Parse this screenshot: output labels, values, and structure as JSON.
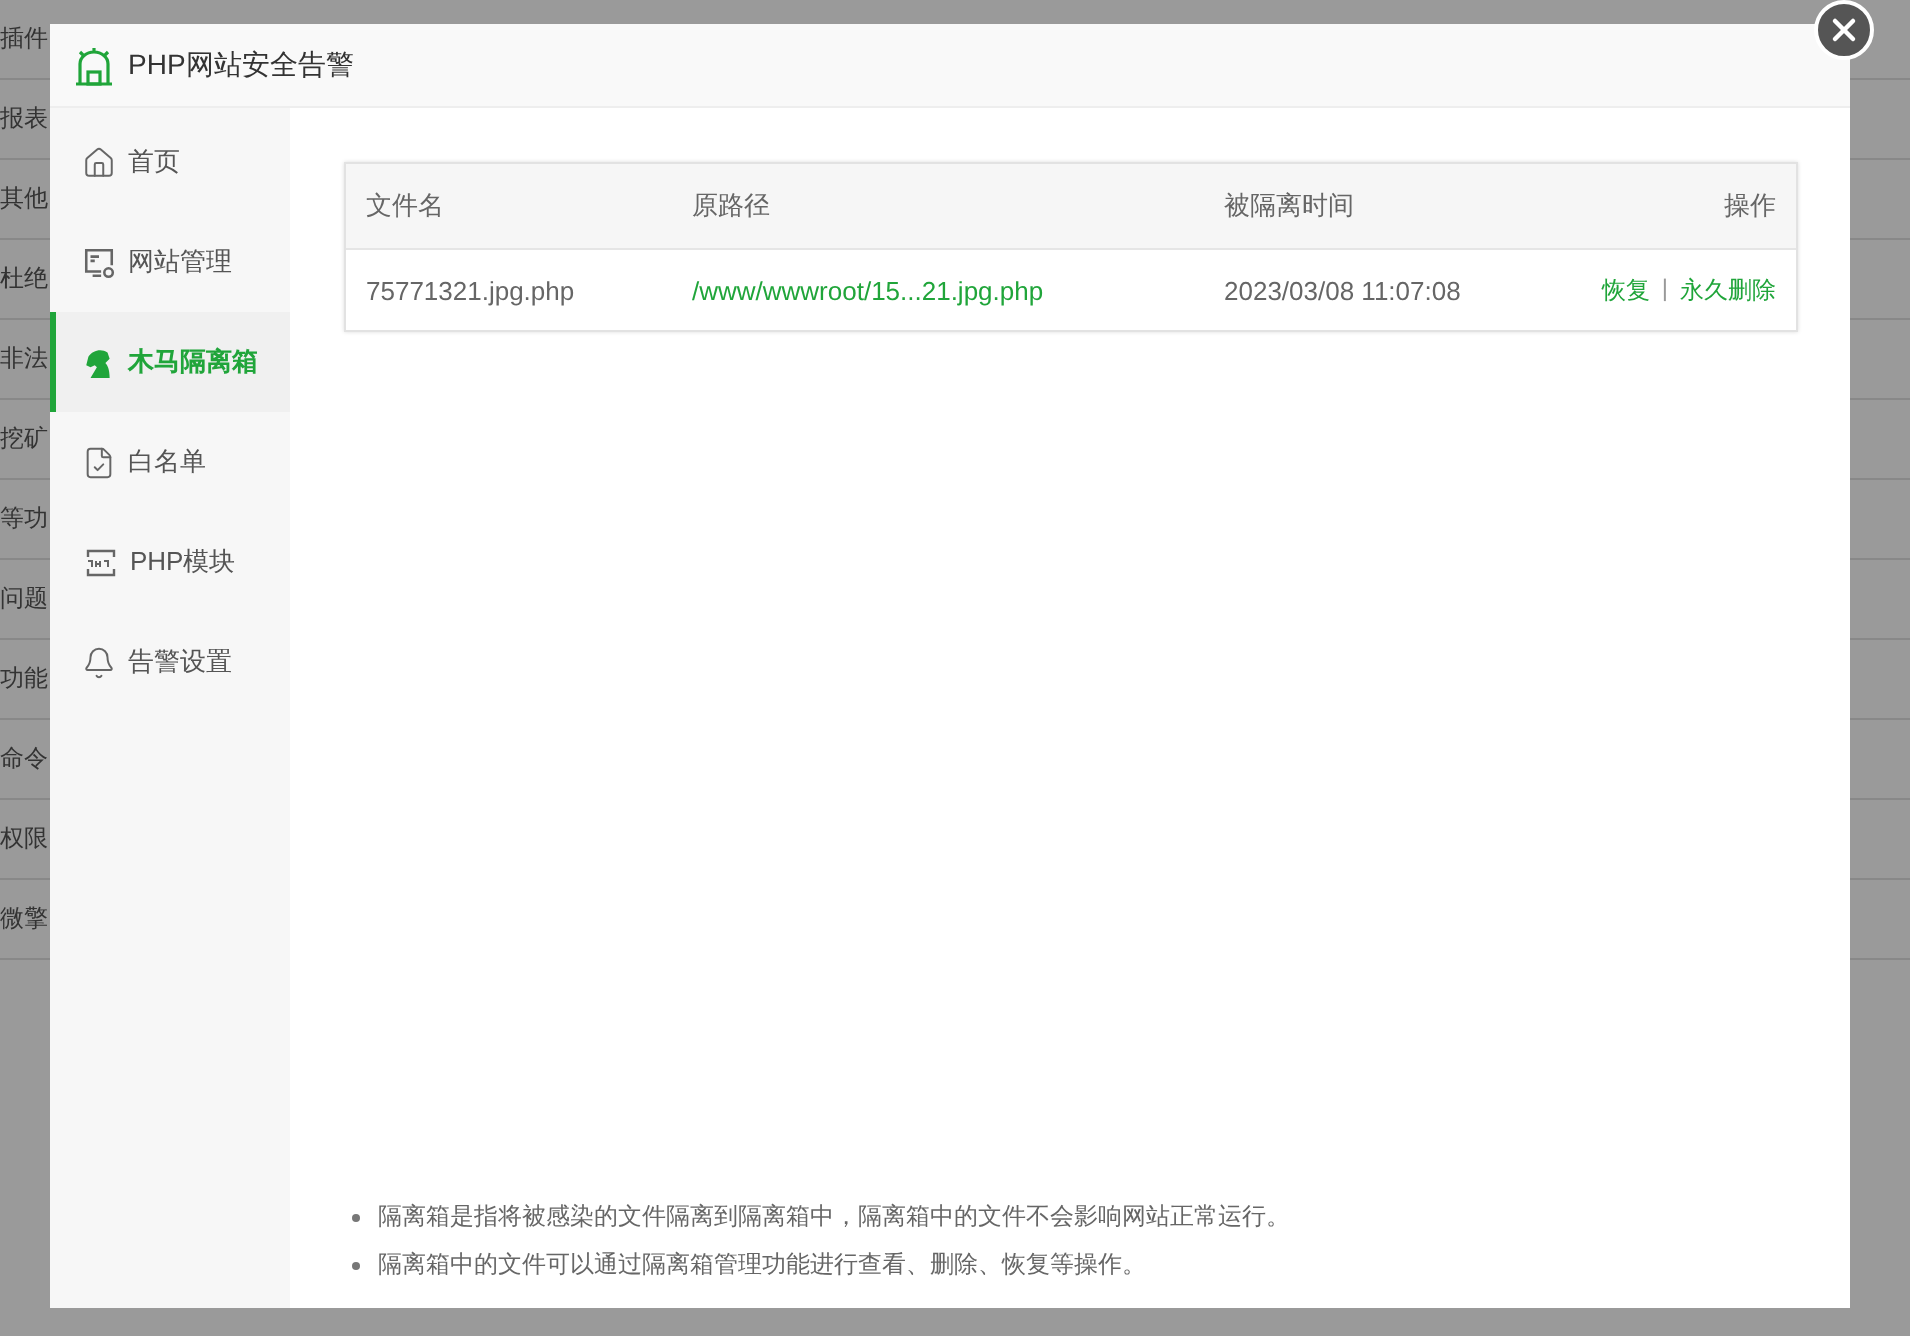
{
  "background_page": {
    "row_fragments": [
      "插件",
      "报表",
      "其他",
      "杜绝",
      "非法",
      "挖矿",
      "等功",
      "问题",
      "功能",
      "命令",
      "权限",
      "微擎"
    ]
  },
  "dialog": {
    "title": "PHP网站安全告警"
  },
  "sidebar": {
    "items": [
      {
        "label": "首页",
        "kind": "home",
        "selected": false
      },
      {
        "label": "网站管理",
        "kind": "sites",
        "selected": false
      },
      {
        "label": "木马隔离箱",
        "kind": "trojan",
        "selected": true
      },
      {
        "label": "白名单",
        "kind": "whitelist",
        "selected": false
      },
      {
        "label": "PHP模块",
        "kind": "module",
        "selected": false
      },
      {
        "label": "告警设置",
        "kind": "alert",
        "selected": false
      }
    ]
  },
  "table": {
    "columns": [
      "文件名",
      "原路径",
      "被隔离时间",
      "操作"
    ],
    "rows": [
      {
        "file": "75771321.jpg.php",
        "path": "/www/wwwroot/15...21.jpg.php",
        "time": "2023/03/08 11:07:08",
        "actions": [
          "恢复",
          "永久删除"
        ],
        "action_separator": "|"
      }
    ]
  },
  "notes": [
    "隔离箱是指将被感染的文件隔离到隔离箱中，隔离箱中的文件不会影响网站正常运行。",
    "隔离箱中的文件可以通过隔离箱管理功能进行查看、删除、恢复等操作。"
  ]
}
